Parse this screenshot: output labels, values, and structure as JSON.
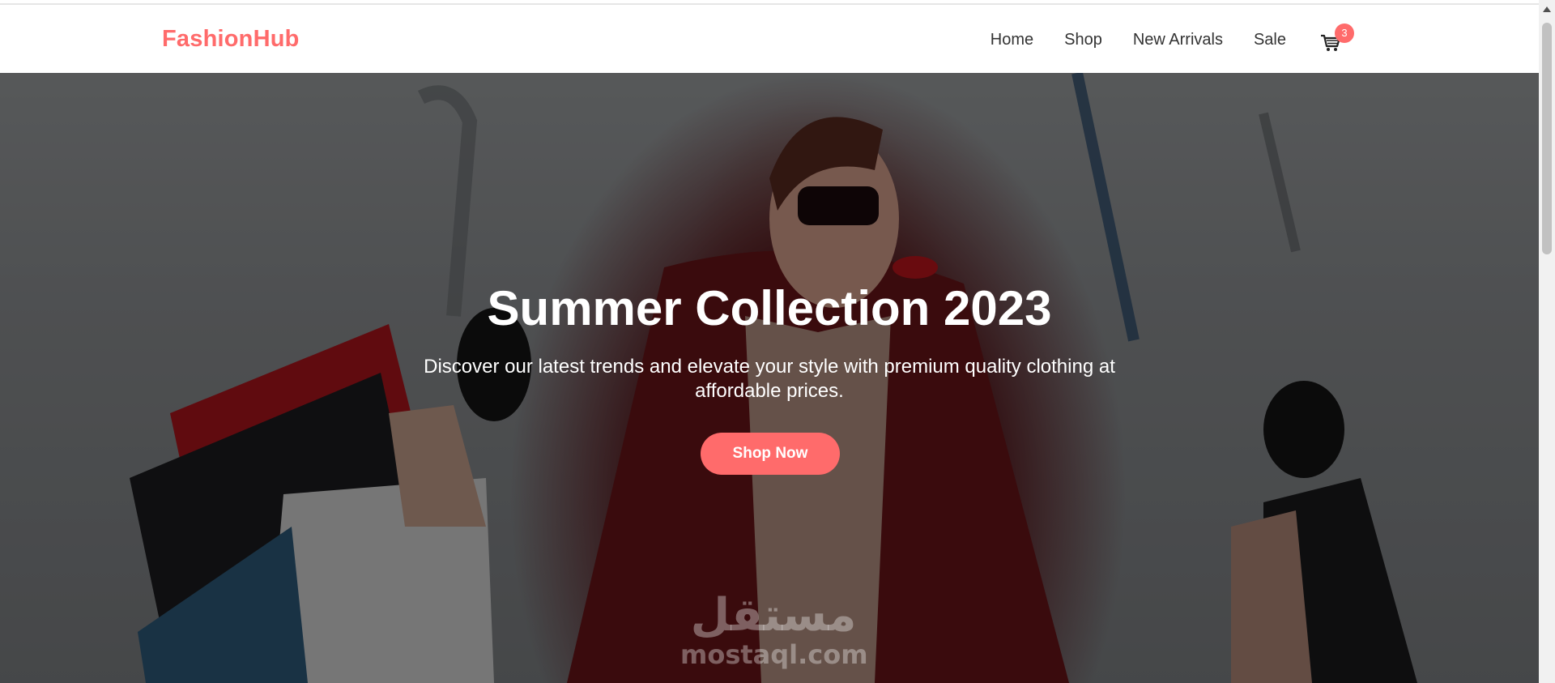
{
  "header": {
    "logo": "FashionHub",
    "nav": [
      "Home",
      "Shop",
      "New Arrivals",
      "Sale"
    ],
    "cart_icon": "cart-icon",
    "cart_count": "3"
  },
  "hero": {
    "title": "Summer Collection 2023",
    "subtitle": "Discover our latest trends and elevate your style with premium quality clothing at affordable prices.",
    "cta": "Shop Now",
    "image_description": "woman in red coat and sunglasses holding shopping bags",
    "watermark_arabic": "مستقل",
    "watermark_domain": "mostaql.com"
  },
  "colors": {
    "accent": "#ff6b6b",
    "nav_text": "#333333",
    "hero_text": "#ffffff"
  }
}
